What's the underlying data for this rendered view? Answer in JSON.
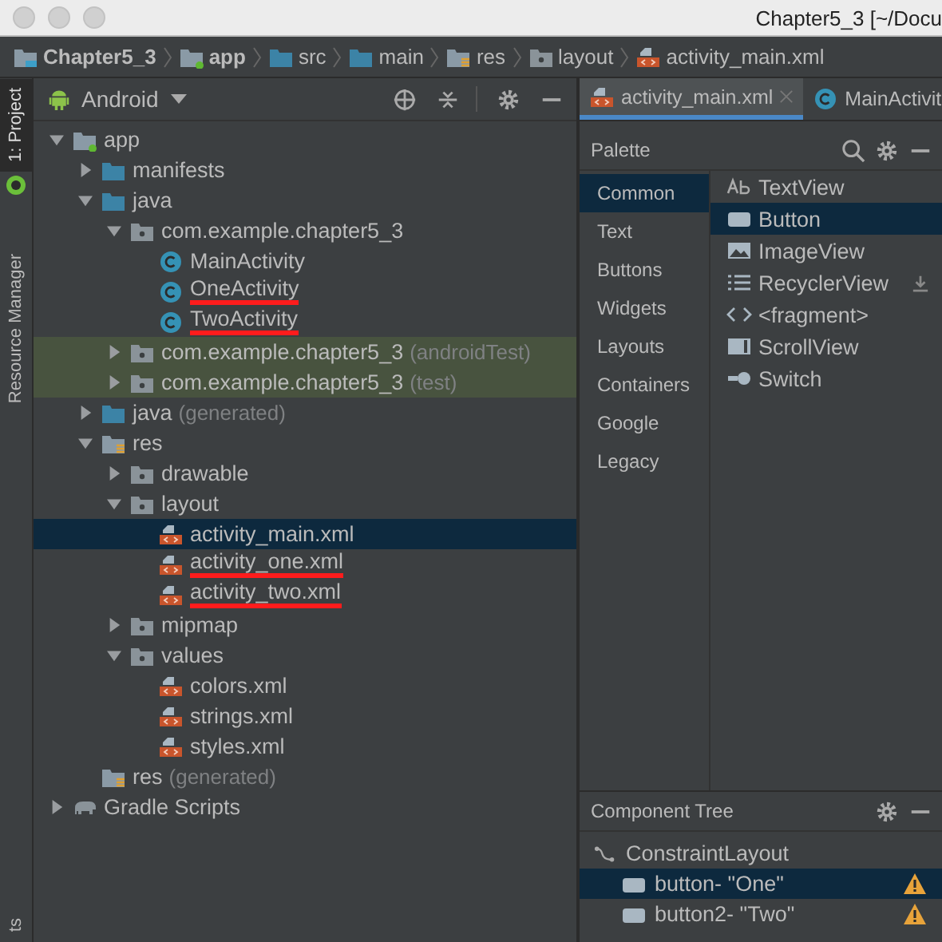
{
  "window": {
    "title": "Chapter5_3 [~/Docu"
  },
  "breadcrumbs": [
    {
      "label": "Chapter5_3",
      "kind": "project"
    },
    {
      "label": "app",
      "kind": "module"
    },
    {
      "label": "src",
      "kind": "folder"
    },
    {
      "label": "main",
      "kind": "folder"
    },
    {
      "label": "res",
      "kind": "res"
    },
    {
      "label": "layout",
      "kind": "package"
    },
    {
      "label": "activity_main.xml",
      "kind": "xml"
    }
  ],
  "side_strip": [
    {
      "label": "1: Project",
      "selected": true
    },
    {
      "label": "Resource Manager",
      "selected": false
    },
    {
      "label": "ts",
      "selected": false
    }
  ],
  "project_panel": {
    "view": "Android",
    "tree": [
      {
        "label": "app",
        "kind": "module",
        "expanded": true,
        "children": [
          {
            "label": "manifests",
            "kind": "folder",
            "expanded": false
          },
          {
            "label": "java",
            "kind": "folder",
            "expanded": true,
            "children": [
              {
                "label": "com.example.chapter5_3",
                "kind": "package",
                "expanded": true,
                "children": [
                  {
                    "label": "MainActivity",
                    "kind": "class",
                    "underlined": false
                  },
                  {
                    "label": "OneActivity",
                    "kind": "class",
                    "underlined": true
                  },
                  {
                    "label": "TwoActivity",
                    "kind": "class",
                    "underlined": true
                  }
                ]
              },
              {
                "label": "com.example.chapter5_3",
                "suffix": "(androidTest)",
                "kind": "package",
                "expanded": false,
                "tinted": true
              },
              {
                "label": "com.example.chapter5_3",
                "suffix": "(test)",
                "kind": "package",
                "expanded": false,
                "tinted": true
              }
            ]
          },
          {
            "label": "java",
            "suffix": "(generated)",
            "kind": "folder",
            "expanded": false
          },
          {
            "label": "res",
            "kind": "res",
            "expanded": true,
            "children": [
              {
                "label": "drawable",
                "kind": "package",
                "expanded": false
              },
              {
                "label": "layout",
                "kind": "package",
                "expanded": true,
                "children": [
                  {
                    "label": "activity_main.xml",
                    "kind": "xml",
                    "selected": true,
                    "underlined": false
                  },
                  {
                    "label": "activity_one.xml",
                    "kind": "xml",
                    "selected": false,
                    "underlined": true
                  },
                  {
                    "label": "activity_two.xml",
                    "kind": "xml",
                    "selected": false,
                    "underlined": true
                  }
                ]
              },
              {
                "label": "mipmap",
                "kind": "package",
                "expanded": false
              },
              {
                "label": "values",
                "kind": "package",
                "expanded": true,
                "children": [
                  {
                    "label": "colors.xml",
                    "kind": "xml",
                    "selected": false
                  },
                  {
                    "label": "strings.xml",
                    "kind": "xml",
                    "selected": false
                  },
                  {
                    "label": "styles.xml",
                    "kind": "xml",
                    "selected": false
                  }
                ]
              }
            ]
          },
          {
            "label": "res",
            "suffix": "(generated)",
            "kind": "res"
          }
        ]
      },
      {
        "label": "Gradle Scripts",
        "kind": "gradle",
        "expanded": false
      }
    ]
  },
  "editor_tabs": [
    {
      "label": "activity_main.xml",
      "kind": "xml",
      "selected": true
    },
    {
      "label": "MainActivit",
      "kind": "class",
      "selected": false
    }
  ],
  "palette": {
    "title": "Palette",
    "categories": [
      {
        "label": "Common",
        "selected": true
      },
      {
        "label": "Text",
        "selected": false
      },
      {
        "label": "Buttons",
        "selected": false
      },
      {
        "label": "Widgets",
        "selected": false
      },
      {
        "label": "Layouts",
        "selected": false
      },
      {
        "label": "Containers",
        "selected": false
      },
      {
        "label": "Google",
        "selected": false
      },
      {
        "label": "Legacy",
        "selected": false
      }
    ],
    "items": [
      {
        "label": "TextView",
        "kind": "text",
        "selected": false
      },
      {
        "label": "Button",
        "kind": "button",
        "selected": true
      },
      {
        "label": "ImageView",
        "kind": "image",
        "selected": false
      },
      {
        "label": "RecyclerView",
        "kind": "list",
        "selected": false,
        "download": true
      },
      {
        "label": "<fragment>",
        "kind": "fragment",
        "selected": false
      },
      {
        "label": "ScrollView",
        "kind": "scroll",
        "selected": false
      },
      {
        "label": "Switch",
        "kind": "switch",
        "selected": false
      }
    ]
  },
  "component_tree": {
    "title": "Component Tree",
    "root": {
      "label": "ConstraintLayout"
    },
    "children": [
      {
        "label": "button- \"One\"",
        "selected": true,
        "warning": true
      },
      {
        "label": "button2- \"Two\"",
        "selected": false,
        "warning": true
      }
    ]
  }
}
